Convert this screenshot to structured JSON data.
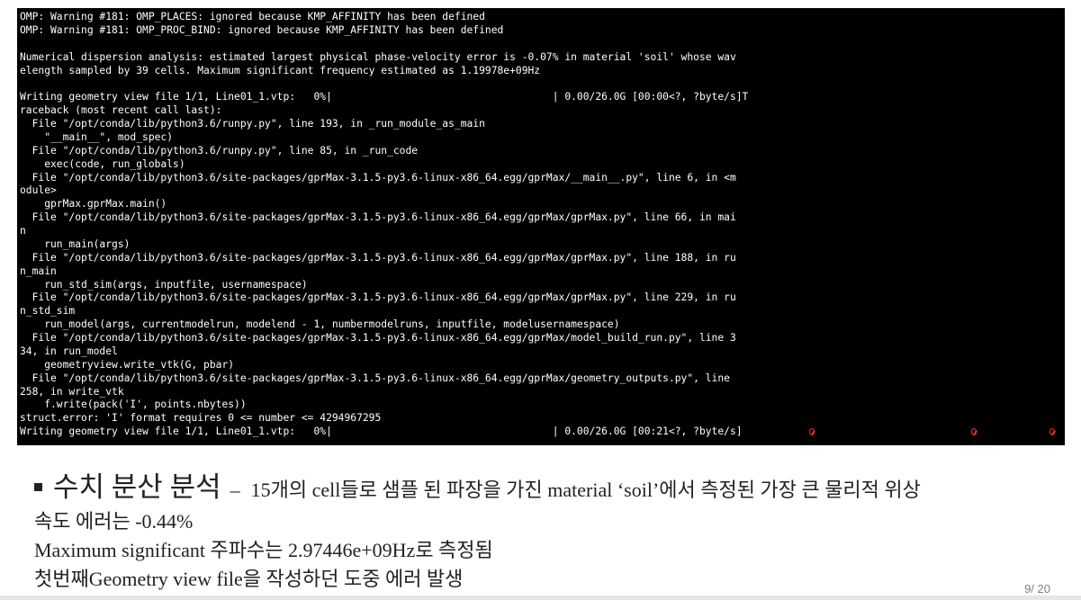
{
  "terminal": {
    "lines": [
      "OMP: Warning #181: OMP_PLACES: ignored because KMP_AFFINITY has been defined",
      "OMP: Warning #181: OMP_PROC_BIND: ignored because KMP_AFFINITY has been defined",
      "",
      "Numerical dispersion analysis: estimated largest physical phase-velocity error is -0.07% in material 'soil' whose wav",
      "elength sampled by 39 cells. Maximum significant frequency estimated as 1.19978e+09Hz",
      "",
      "Writing geometry view file 1/1, Line01_1.vtp:   0%|                                    | 0.00/26.0G [00:00<?, ?byte/s]T",
      "raceback (most recent call last):",
      "  File \"/opt/conda/lib/python3.6/runpy.py\", line 193, in _run_module_as_main",
      "    \"__main__\", mod_spec)",
      "  File \"/opt/conda/lib/python3.6/runpy.py\", line 85, in _run_code",
      "    exec(code, run_globals)",
      "  File \"/opt/conda/lib/python3.6/site-packages/gprMax-3.1.5-py3.6-linux-x86_64.egg/gprMax/__main__.py\", line 6, in <m",
      "odule>",
      "    gprMax.gprMax.main()",
      "  File \"/opt/conda/lib/python3.6/site-packages/gprMax-3.1.5-py3.6-linux-x86_64.egg/gprMax/gprMax.py\", line 66, in mai",
      "n",
      "    run_main(args)",
      "  File \"/opt/conda/lib/python3.6/site-packages/gprMax-3.1.5-py3.6-linux-x86_64.egg/gprMax/gprMax.py\", line 188, in ru",
      "n_main",
      "    run_std_sim(args, inputfile, usernamespace)",
      "  File \"/opt/conda/lib/python3.6/site-packages/gprMax-3.1.5-py3.6-linux-x86_64.egg/gprMax/gprMax.py\", line 229, in ru",
      "n_std_sim",
      "    run_model(args, currentmodelrun, modelend - 1, numbermodelruns, inputfile, modelusernamespace)",
      "  File \"/opt/conda/lib/python3.6/site-packages/gprMax-3.1.5-py3.6-linux-x86_64.egg/gprMax/model_build_run.py\", line 3",
      "34, in run_model",
      "    geometryview.write_vtk(G, pbar)",
      "  File \"/opt/conda/lib/python3.6/site-packages/gprMax-3.1.5-py3.6-linux-x86_64.egg/gprMax/geometry_outputs.py\", line",
      "258, in write_vtk",
      "    f.write(pack('I', points.nbytes))",
      "struct.error: 'I' format requires 0 <= number <= 4294967295",
      "Writing geometry view file 1/1, Line01_1.vtp:   0%|                                    | 0.00/26.0G [00:21<?, ?byte/s]"
    ],
    "marker_color": "#ff2a2a"
  },
  "slide": {
    "heading": "수치 분산 분석",
    "dash": "–",
    "line1": "15개의 cell들로 샘플 된 파장을 가진 material ‘soil’에서 측정된 가장 큰 물리적 위상",
    "line2": "속도 에러는 -0.44%",
    "line3": "Maximum significant 주파수는 2.97446e+09Hz로 측정됨",
    "line4": "첫번째Geometry view file을 작성하던 도중 에러 발생",
    "page_number": "9/ 20"
  }
}
